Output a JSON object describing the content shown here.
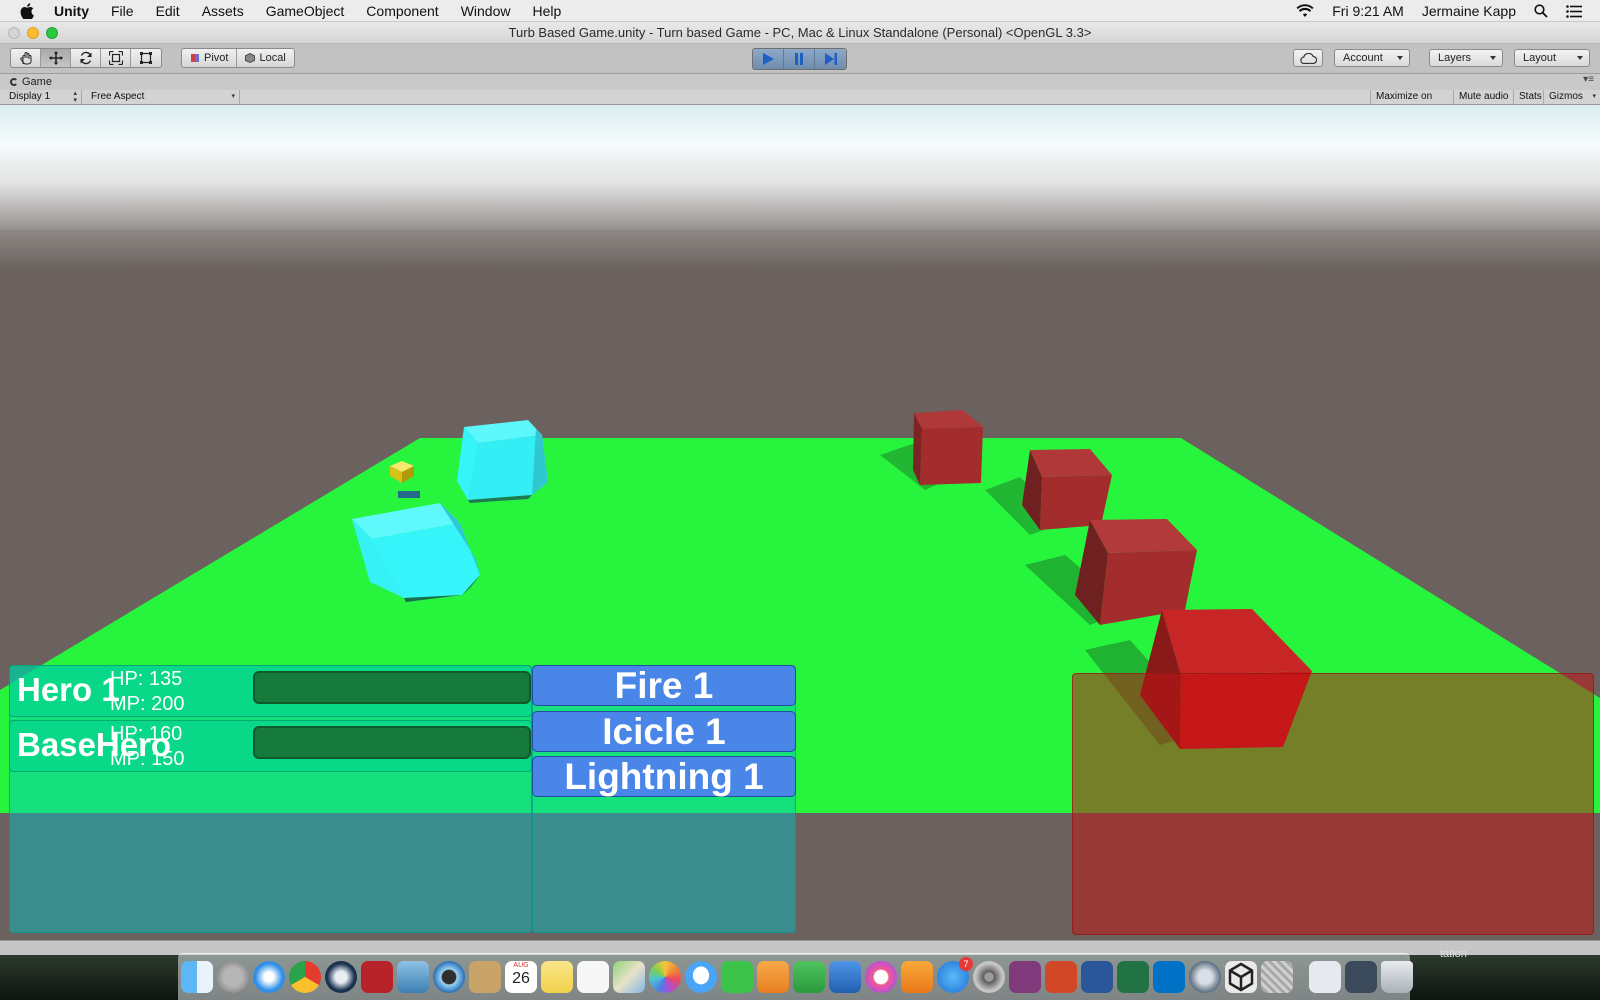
{
  "menubar": {
    "app_name": "Unity",
    "items": [
      "File",
      "Edit",
      "Assets",
      "GameObject",
      "Component",
      "Window",
      "Help"
    ],
    "clock": "Fri 9:21 AM",
    "user": "Jermaine Kapp"
  },
  "window": {
    "title": "Turb Based Game.unity - Turn based Game - PC, Mac & Linux Standalone (Personal) <OpenGL 3.3>"
  },
  "toolbar": {
    "pivot_label": "Pivot",
    "local_label": "Local",
    "account_label": "Account",
    "layers_label": "Layers",
    "layout_label": "Layout"
  },
  "game_view": {
    "tab_label": "Game",
    "display_select": "Display 1",
    "aspect_select": "Free Aspect",
    "maximize_on_play": "Maximize on Play",
    "mute_audio": "Mute audio",
    "stats": "Stats",
    "gizmos": "Gizmos"
  },
  "heroes": [
    {
      "name": "Hero 1",
      "hp": "HP: 135",
      "mp": "MP: 200"
    },
    {
      "name": "BaseHero",
      "hp": "HP: 160",
      "mp": "MP: 150"
    }
  ],
  "actions": [
    "Fire 1",
    "Icicle 1",
    "Lightning 1"
  ],
  "desktop": {
    "partial_label": "tation"
  },
  "dock": {
    "calendar_month": "AUG",
    "calendar_day": "26",
    "appstore_badge": "7",
    "icons": [
      "finder-icon",
      "launchpad-icon",
      "safari-icon",
      "chrome-icon",
      "steam-icon",
      "photo-booth-icon",
      "preview-icon",
      "quicktime-icon",
      "contacts-icon",
      "calendar-icon",
      "notes-icon",
      "reminders-icon",
      "maps-icon",
      "photos-icon",
      "messages-icon",
      "facetime-icon",
      "pages-icon",
      "numbers-icon",
      "keynote-icon",
      "itunes-icon",
      "ibooks-icon",
      "app-store-icon",
      "system-preferences-icon",
      "onenote-icon",
      "powerpoint-icon",
      "word-icon",
      "excel-icon",
      "outlook-icon",
      "remote-desktop-icon",
      "unity-icon",
      "scanner-icon"
    ]
  },
  "colors": {
    "ground": "#27f53d",
    "hero_cube": "#35f5fb",
    "enemy_cube": "#a32c2c",
    "action_button": "#4a86e8",
    "hero_panel": "#00c8c8",
    "enemy_panel": "#be1414"
  }
}
